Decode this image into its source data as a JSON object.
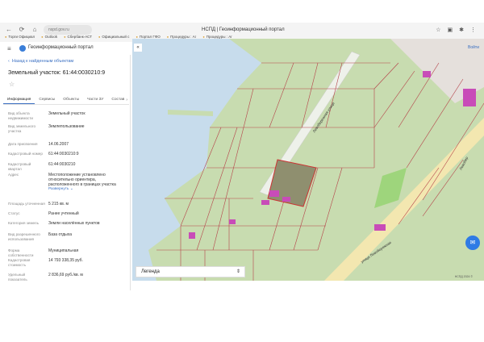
{
  "browser": {
    "url": "nspd.gov.ru",
    "tab_title": "НСПД | Геоинформационный портал",
    "bookmarks": [
      "Торги Официал",
      "Outlook",
      "Сбербанк-АСТ",
      "Официальный с",
      "Портал ГФО",
      "Процедуры : Аг",
      "Процедуры : Аг"
    ]
  },
  "app": {
    "name": "Геоинформационный портал"
  },
  "sidebar": {
    "back_label": "Назад к найденным объектам",
    "title": "Земельный участок: 61:44:0030210:9",
    "tabs": [
      "Информация",
      "Сервисы",
      "Объекты",
      "Части ЗУ",
      "Состав"
    ],
    "properties": [
      {
        "label": "Вид объекта недвижимости",
        "value": "Земельный участок"
      },
      {
        "label": "Вид земельного участка",
        "value": "Землепользование"
      },
      {
        "label": "Дата присвоения",
        "value": "14.06.2007"
      },
      {
        "label": "Кадастровый номер",
        "value": "61:44:0030210:9"
      },
      {
        "label": "Кадастровый квартал",
        "value": "61:44:0030210"
      },
      {
        "label": "Адрес",
        "value": "Местоположение установлено относительно ориентира, расположенного в границах участка",
        "link": "Развернуть"
      },
      {
        "label": "Площадь уточненная",
        "value": "5 215 кв. м"
      },
      {
        "label": "Статус",
        "value": "Ранее учтенный"
      },
      {
        "label": "Категория земель",
        "value": "Земли населённых пунктов"
      },
      {
        "label": "Вид разрешенного использования",
        "value": "База отдыха"
      },
      {
        "label": "Форма собственности",
        "value": "Муниципальная"
      },
      {
        "label": "Кадастровая стоимость",
        "value": "14 793 338,35 руб."
      },
      {
        "label": "Удельный показатель",
        "value": "2 836,69 руб./кв. м"
      }
    ]
  },
  "map": {
    "login_label": "Войти",
    "legend_label": "Легенда",
    "streets": [
      "Левобережная улица",
      "улица Левобережная",
      "Левобер"
    ],
    "attribution": "НСПД 2024 ©"
  },
  "colors": {
    "water": "#c7dcec",
    "land": "#c8dcb0",
    "parcel_line": "#b5434a",
    "selected": "#8f8f6f",
    "road": "#f3e7b0",
    "accent": "#2f7be5"
  }
}
